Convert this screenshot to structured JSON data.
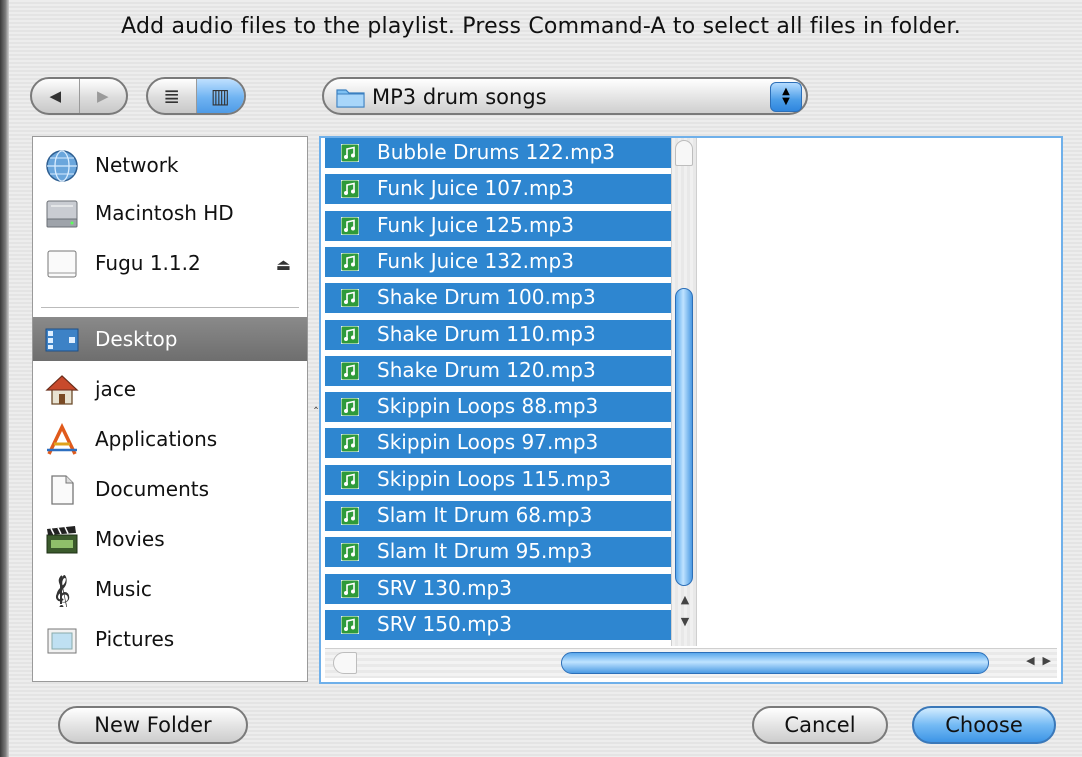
{
  "dialog": {
    "title": "Add audio files to the playlist. Press Command-A to select all files in folder."
  },
  "toolbar": {
    "back_glyph": "◀",
    "forward_glyph": "▶",
    "list_view_glyph": "≣",
    "column_view_glyph": "▥",
    "location_popup": {
      "label": "MP3 drum songs",
      "icon": "folder-icon",
      "arrows_glyph_up": "▲",
      "arrows_glyph_down": "▼"
    }
  },
  "sidebar": {
    "devices": [
      {
        "label": "Network",
        "icon": "network-icon"
      },
      {
        "label": "Macintosh HD",
        "icon": "hard-drive-icon"
      },
      {
        "label": "Fugu 1.1.2",
        "icon": "disk-image-icon",
        "eject_glyph": "⏏"
      }
    ],
    "places": [
      {
        "label": "Desktop",
        "icon": "desktop-icon",
        "selected": true
      },
      {
        "label": "jace",
        "icon": "home-icon"
      },
      {
        "label": "Applications",
        "icon": "applications-icon"
      },
      {
        "label": "Documents",
        "icon": "documents-icon"
      },
      {
        "label": "Movies",
        "icon": "movies-icon"
      },
      {
        "label": "Music",
        "icon": "music-icon"
      },
      {
        "label": "Pictures",
        "icon": "pictures-icon"
      }
    ],
    "resize_glyph": "‸"
  },
  "files": {
    "items": [
      "Bubble Drums 122.mp3",
      "Funk Juice 107.mp3",
      "Funk Juice 125.mp3",
      "Funk Juice 132.mp3",
      "Shake Drum 100.mp3",
      "Shake Drum 110.mp3",
      "Shake Drum 120.mp3",
      "Skippin Loops 88.mp3",
      "Skippin Loops 97.mp3",
      "Skippin Loops 115.mp3",
      "Slam It Drum 68.mp3",
      "Slam It Drum 95.mp3",
      "SRV 130.mp3",
      "SRV 150.mp3"
    ],
    "selection_color": "#2e86d0",
    "scroll_up_glyph": "▲",
    "scroll_down_glyph": "▼",
    "scroll_left_glyph": "◀",
    "scroll_right_glyph": "▶"
  },
  "buttons": {
    "new_folder": "New Folder",
    "cancel": "Cancel",
    "choose": "Choose"
  },
  "colors": {
    "accent": "#3d95e6",
    "sidebar_selected": "#7a7a7a"
  }
}
